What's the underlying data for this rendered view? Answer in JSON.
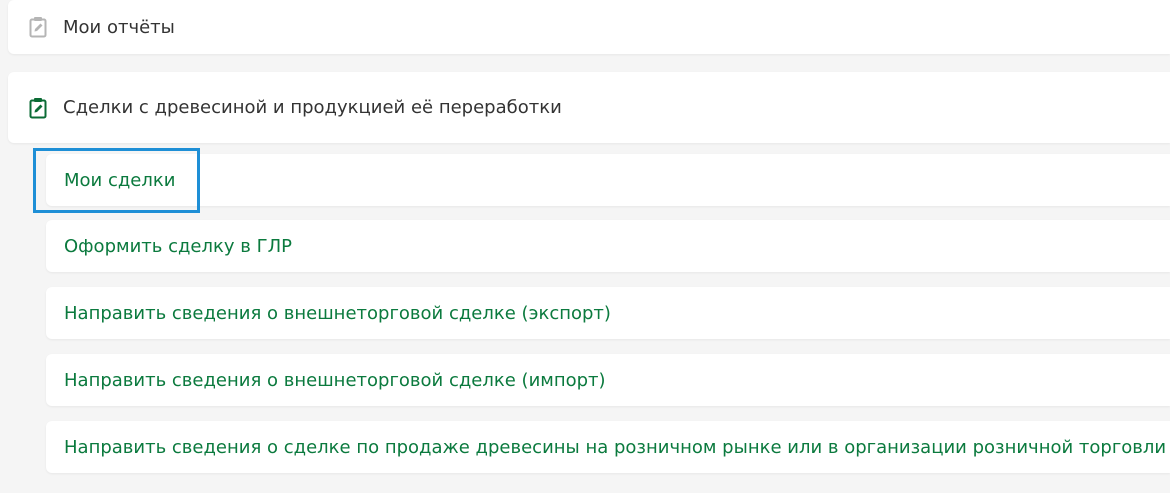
{
  "menu": {
    "my_reports": {
      "label": "Мои отчёты",
      "icon": "clipboard-edit-icon",
      "icon_color": "#b5b5b5"
    },
    "wood_deals": {
      "label": "Сделки с древесиной и продукцией её переработки",
      "icon": "clipboard-edit-icon",
      "icon_color": "#0b6b35",
      "items": [
        {
          "label": "Мои сделки"
        },
        {
          "label": "Оформить сделку в ГЛР"
        },
        {
          "label": "Направить сведения о внешнеторговой сделке (экспорт)"
        },
        {
          "label": "Направить сведения о внешнеторговой сделке (импорт)"
        },
        {
          "label": "Направить сведения о сделке по продаже древесины на розничном рынке или в организации розничной торговли"
        }
      ]
    }
  },
  "colors": {
    "background": "#f5f5f5",
    "card": "#ffffff",
    "section_text": "#333333",
    "link_text": "#0b7a3e",
    "focus": "#1e8fd6"
  }
}
